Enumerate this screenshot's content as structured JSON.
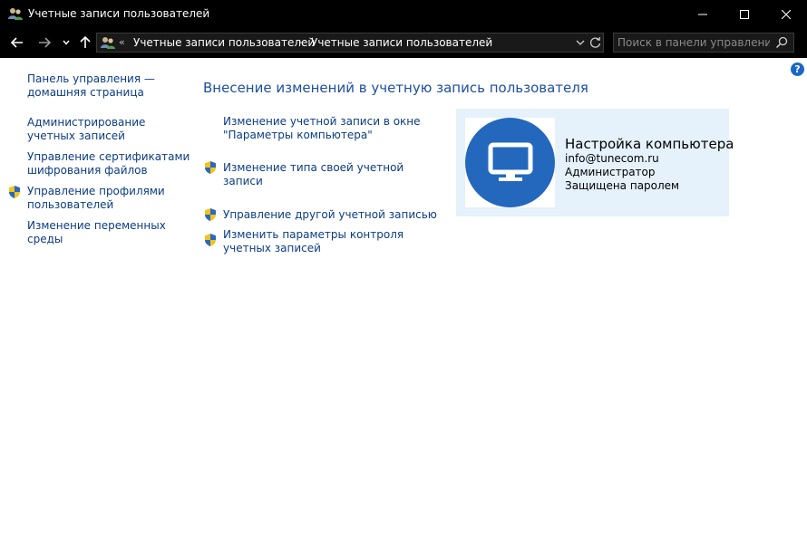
{
  "window": {
    "title": "Учетные записи пользователей"
  },
  "addressbar": {
    "overflow": "«",
    "crumbs": [
      "Учетные записи пользователей",
      "Учетные записи пользователей"
    ],
    "search_placeholder": "Поиск в панели управления"
  },
  "help": {
    "label": "?"
  },
  "sidebar": {
    "home": "Панель управления — домашняя страница",
    "links": [
      {
        "label": "Администрирование учетных записей",
        "shield": false
      },
      {
        "label": "Управление сертификатами шифрования файлов",
        "shield": false
      },
      {
        "label": "Управление профилями пользователей",
        "shield": true
      },
      {
        "label": "Изменение переменных среды",
        "shield": false
      }
    ]
  },
  "main": {
    "heading": "Внесение изменений в учетную запись пользователя",
    "tasks": [
      {
        "label": "Изменение учетной записи в окне \"Параметры компьютера\"",
        "shield": false
      },
      {
        "label": "Изменение типа своей учетной записи",
        "shield": true
      },
      {
        "label": "Управление другой учетной записью",
        "shield": true
      },
      {
        "label": "Изменить параметры контроля учетных записей",
        "shield": true
      }
    ]
  },
  "account": {
    "name": "Настройка компьютера",
    "email": "info@tunecom.ru",
    "type": "Администратор",
    "protection": "Защищена паролем"
  },
  "colors": {
    "titlebar": "#000000",
    "link": "#1a67c2",
    "heading": "#1e4ea3",
    "card_bg": "#e5f1fb",
    "avatar": "#2468bd"
  }
}
